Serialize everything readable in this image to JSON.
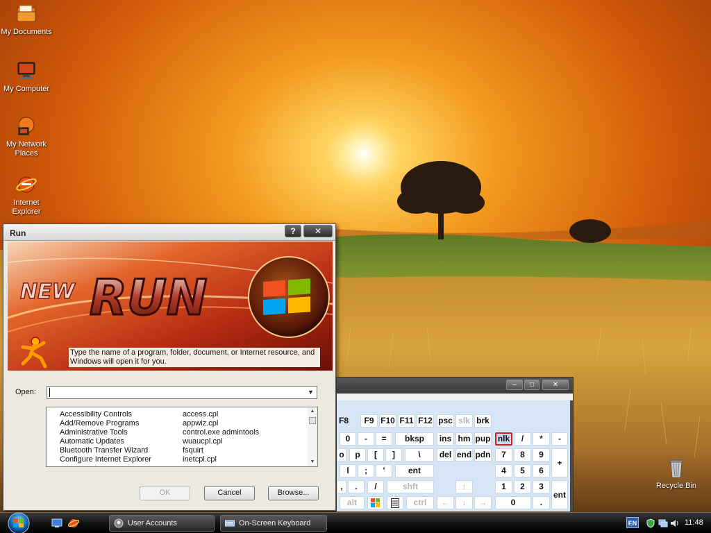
{
  "desktop": {
    "icons": [
      {
        "label": "My Documents",
        "icon": "folder-documents-icon"
      },
      {
        "label": "My Computer",
        "icon": "computer-icon"
      },
      {
        "label": "My Network Places",
        "icon": "network-icon"
      },
      {
        "label": "Internet Explorer",
        "icon": "internet-explorer-icon"
      },
      {
        "label": "Recycle Bin",
        "icon": "recycle-bin-icon"
      }
    ]
  },
  "run_dialog": {
    "title": "Run",
    "help_button": "?",
    "close_button": "✕",
    "banner_text": "RUN",
    "banner_badge": "NEW",
    "description": "Type the name of a program, folder, document, or Internet resource, and Windows will open it for you.",
    "open_label": "Open:",
    "open_value": "",
    "items": [
      {
        "name": "Accessibility Controls",
        "file": "access.cpl"
      },
      {
        "name": "Add/Remove Programs",
        "file": "appwiz.cpl"
      },
      {
        "name": "Administrative Tools",
        "file": "control.exe admintools"
      },
      {
        "name": "Automatic Updates",
        "file": "wuaucpl.cpl"
      },
      {
        "name": "Bluetooth Transfer Wizard",
        "file": "fsquirt"
      },
      {
        "name": "Configure Internet Explorer",
        "file": "inetcpl.cpl"
      }
    ],
    "buttons": {
      "ok": "OK",
      "cancel": "Cancel",
      "browse": "Browse..."
    }
  },
  "osk": {
    "title_buttons": {
      "minimize": "–",
      "maximize": "□",
      "close": "✕"
    },
    "keys": {
      "f8": "F8",
      "f9": "F9",
      "f10": "F10",
      "f11": "F11",
      "f12": "F12",
      "psc": "psc",
      "slk": "slk",
      "brk": "brk",
      "zero": "0",
      "minus": "-",
      "equals": "=",
      "bksp": "bksp",
      "ins": "ins",
      "hm": "hm",
      "pup": "pup",
      "nlk": "nlk",
      "slash": "/",
      "star": "*",
      "num_minus": "-",
      "o": "o",
      "p": "p",
      "lbracket": "[",
      "rbracket": "]",
      "backslash": "\\",
      "del": "del",
      "end": "end",
      "pdn": "pdn",
      "n7": "7",
      "n8": "8",
      "n9": "9",
      "l": "l",
      "semicolon": ";",
      "quote": "'",
      "ent": "ent",
      "n4": "4",
      "n5": "5",
      "n6": "6",
      "num_plus": "+",
      "comma": ",",
      "period": ".",
      "fslash": "/",
      "shft": "shft",
      "up": "↑",
      "n1": "1",
      "n2": "2",
      "n3": "3",
      "alt": "alt",
      "ctrl": "ctrl",
      "left": "←",
      "down": "↓",
      "right": "→",
      "n0": "0",
      "num_period": ".",
      "num_ent": "ent"
    }
  },
  "taskbar": {
    "tasks": [
      {
        "label": "User Accounts"
      },
      {
        "label": "On-Screen Keyboard"
      }
    ],
    "language": "EN",
    "clock": "11:48"
  }
}
